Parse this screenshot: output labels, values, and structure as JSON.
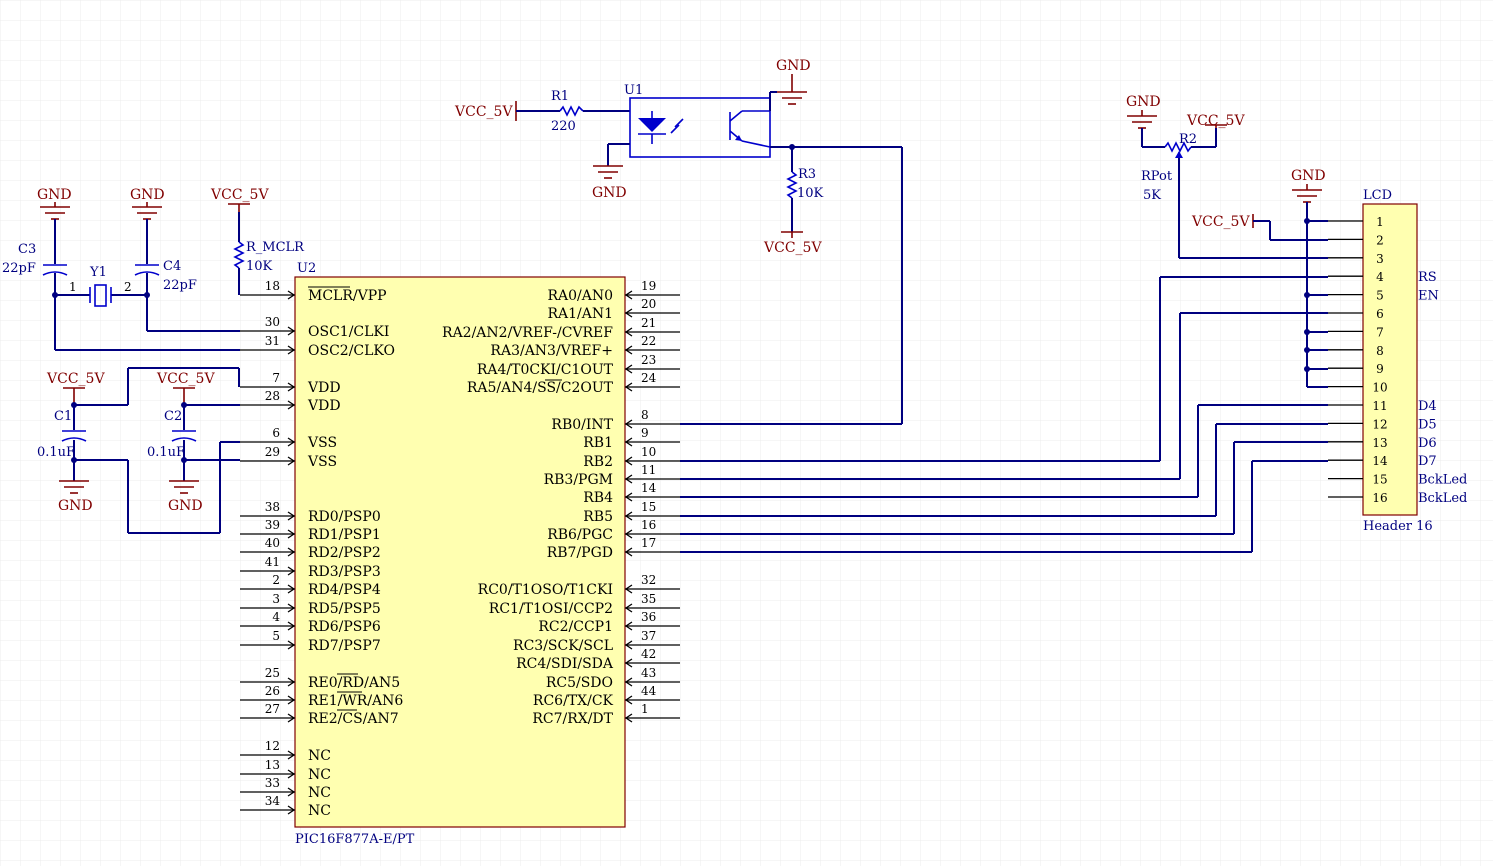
{
  "colors": {
    "wire": "#000080",
    "pin": "#000000",
    "power": "#800000",
    "part": "#0000cc",
    "chip_fill": "#ffffb0",
    "grid": "#ececec"
  },
  "power": {
    "gnd": "GND",
    "vcc": "VCC_5V"
  },
  "mcu": {
    "ref": "U2",
    "part": "PIC16F877A-E/PT",
    "left_pins": [
      {
        "num": "18",
        "name": "MCLR/VPP"
      },
      {
        "num": "30",
        "name": "OSC1/CLKI"
      },
      {
        "num": "31",
        "name": "OSC2/CLKO"
      },
      {
        "num": "7",
        "name": "VDD"
      },
      {
        "num": "28",
        "name": "VDD"
      },
      {
        "num": "6",
        "name": "VSS"
      },
      {
        "num": "29",
        "name": "VSS"
      },
      {
        "num": "38",
        "name": "RD0/PSP0"
      },
      {
        "num": "39",
        "name": "RD1/PSP1"
      },
      {
        "num": "40",
        "name": "RD2/PSP2"
      },
      {
        "num": "41",
        "name": "RD3/PSP3"
      },
      {
        "num": "2",
        "name": "RD4/PSP4"
      },
      {
        "num": "3",
        "name": "RD5/PSP5"
      },
      {
        "num": "4",
        "name": "RD6/PSP6"
      },
      {
        "num": "5",
        "name": "RD7/PSP7"
      },
      {
        "num": "25",
        "name": "RE0/RD/AN5"
      },
      {
        "num": "26",
        "name": "RE1/WR/AN6"
      },
      {
        "num": "27",
        "name": "RE2/CS/AN7"
      },
      {
        "num": "12",
        "name": "NC"
      },
      {
        "num": "13",
        "name": "NC"
      },
      {
        "num": "33",
        "name": "NC"
      },
      {
        "num": "34",
        "name": "NC"
      }
    ],
    "right_pins": [
      {
        "num": "19",
        "name": "RA0/AN0"
      },
      {
        "num": "20",
        "name": "RA1/AN1"
      },
      {
        "num": "21",
        "name": "RA2/AN2/VREF-/CVREF"
      },
      {
        "num": "22",
        "name": "RA3/AN3/VREF+"
      },
      {
        "num": "23",
        "name": "RA4/T0CKI/C1OUT"
      },
      {
        "num": "24",
        "name": "RA5/AN4/SS/C2OUT"
      },
      {
        "num": "8",
        "name": "RB0/INT"
      },
      {
        "num": "9",
        "name": "RB1"
      },
      {
        "num": "10",
        "name": "RB2"
      },
      {
        "num": "11",
        "name": "RB3/PGM"
      },
      {
        "num": "14",
        "name": "RB4"
      },
      {
        "num": "15",
        "name": "RB5"
      },
      {
        "num": "16",
        "name": "RB6/PGC"
      },
      {
        "num": "17",
        "name": "RB7/PGD"
      },
      {
        "num": "32",
        "name": "RC0/T1OSO/T1CKI"
      },
      {
        "num": "35",
        "name": "RC1/T1OSI/CCP2"
      },
      {
        "num": "36",
        "name": "RC2/CCP1"
      },
      {
        "num": "37",
        "name": "RC3/SCK/SCL"
      },
      {
        "num": "42",
        "name": "RC4/SDI/SDA"
      },
      {
        "num": "43",
        "name": "RC5/SDO"
      },
      {
        "num": "44",
        "name": "RC6/TX/CK"
      },
      {
        "num": "1",
        "name": "RC7/RX/DT"
      }
    ]
  },
  "lcd": {
    "ref": "LCD",
    "part": "Header 16",
    "pins": [
      "1",
      "2",
      "3",
      "4",
      "5",
      "6",
      "7",
      "8",
      "9",
      "10",
      "11",
      "12",
      "13",
      "14",
      "15",
      "16"
    ],
    "labels": [
      "",
      "",
      "",
      "RS",
      "EN",
      "",
      "",
      "",
      "",
      "",
      "D4",
      "D5",
      "D6",
      "D7",
      "BckLed",
      "BckLed"
    ]
  },
  "components": {
    "c3": {
      "ref": "C3",
      "value": "22pF"
    },
    "c4": {
      "ref": "C4",
      "value": "22pF"
    },
    "y1": {
      "ref": "Y1",
      "pin1": "1",
      "pin2": "2"
    },
    "c1": {
      "ref": "C1",
      "value": "0.1uF"
    },
    "c2": {
      "ref": "C2",
      "value": "0.1uF"
    },
    "r_mclr": {
      "ref": "R_MCLR",
      "value": "10K"
    },
    "r1": {
      "ref": "R1",
      "value": "220"
    },
    "u1": {
      "ref": "U1"
    },
    "r3": {
      "ref": "R3",
      "value": "10K"
    },
    "r2": {
      "ref": "R2",
      "type": "RPot",
      "value": "5K"
    }
  }
}
